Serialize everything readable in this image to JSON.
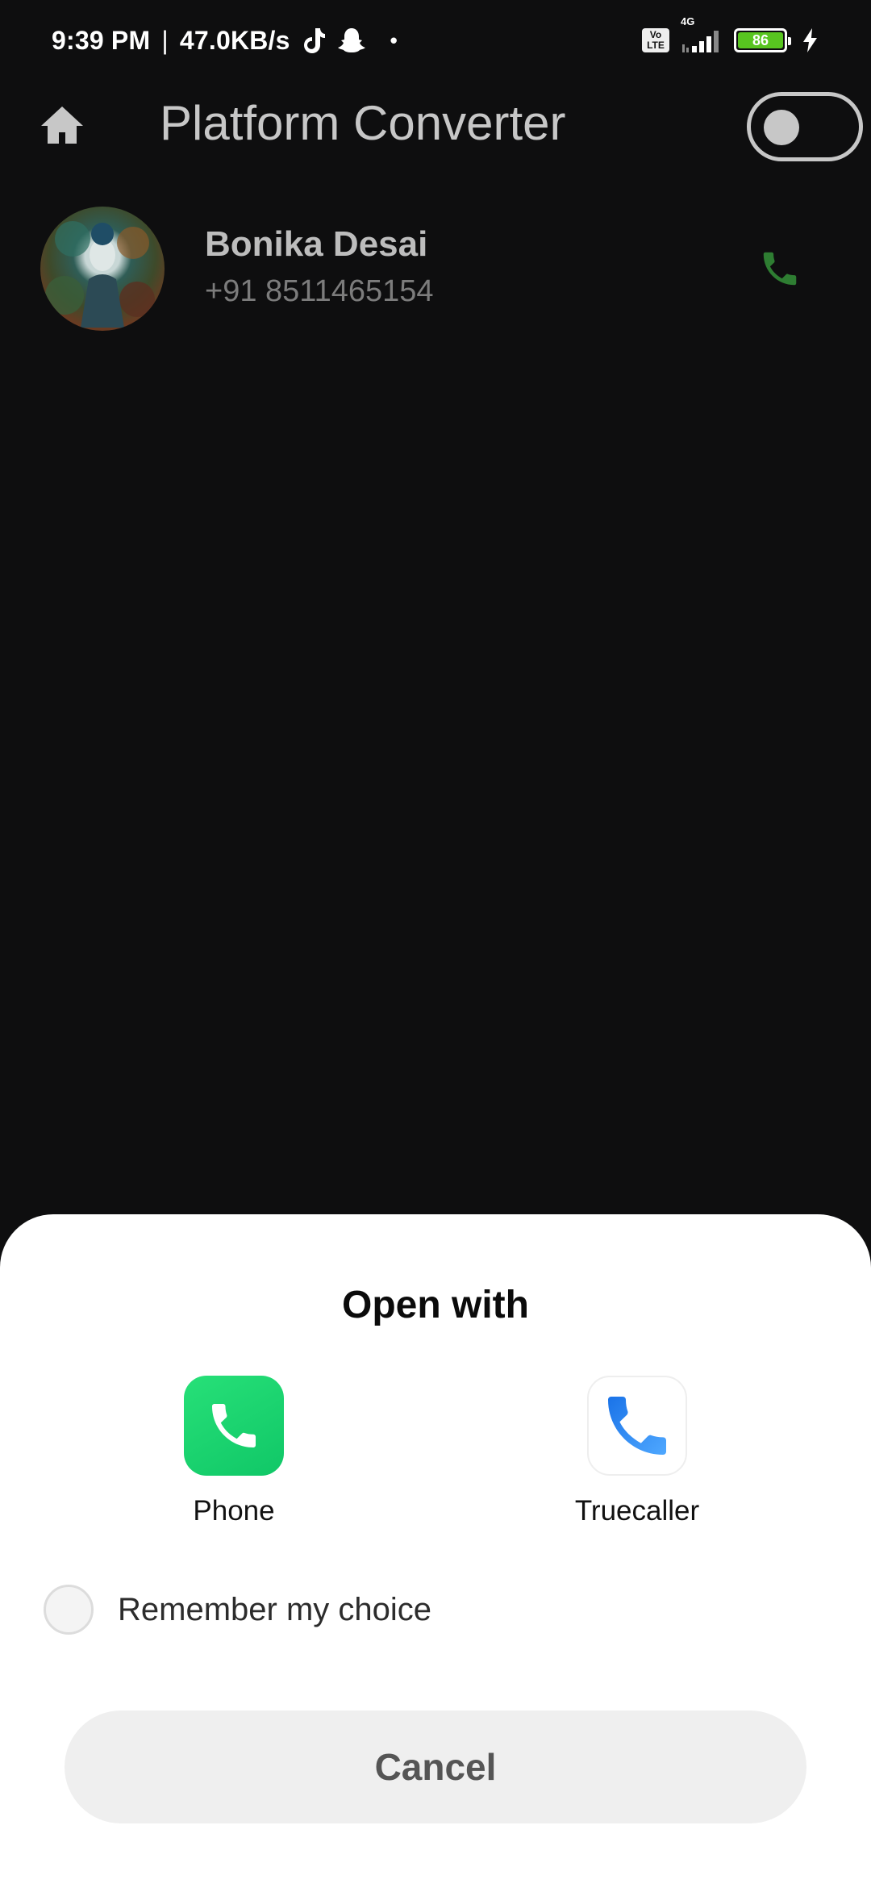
{
  "status_bar": {
    "time": "9:39 PM",
    "separator": "|",
    "speed": "47.0KB/s",
    "dot": "•",
    "volte_top": "Vo",
    "volte_bottom": "LTE",
    "network": "4G",
    "battery": "86",
    "icons": [
      "tiktok-icon",
      "snapchat-icon",
      "signal-icon",
      "battery-icon",
      "charging-icon"
    ]
  },
  "app_bar": {
    "title": "Platform Converter",
    "icons": [
      "home-icon",
      "theme-toggle"
    ]
  },
  "contact": {
    "name": "Bonika Desai",
    "number": "+91 8511465154",
    "call_color": "#2e7d32"
  },
  "sheet": {
    "title": "Open with",
    "options": [
      {
        "label": "Phone",
        "icon": "phone-app-icon",
        "color": "#19d46f"
      },
      {
        "label": "Truecaller",
        "icon": "truecaller-icon",
        "color": "#2a8cf3"
      }
    ],
    "remember_label": "Remember my choice",
    "cancel_label": "Cancel"
  }
}
